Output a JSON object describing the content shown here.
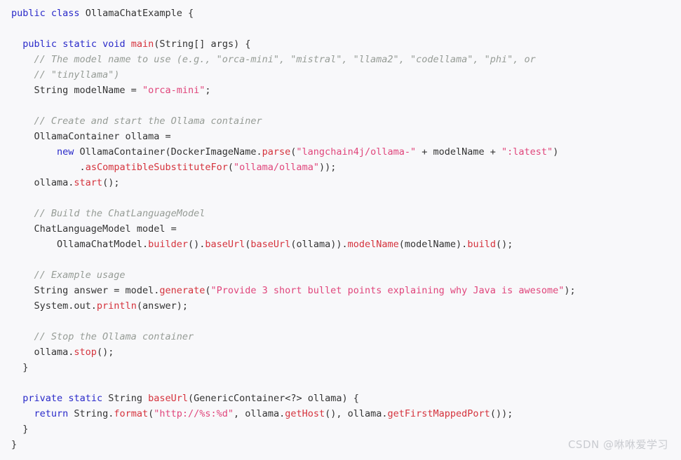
{
  "editor": {
    "language": "java",
    "background_color": "#f8f8fa",
    "default_text_color": "#333333",
    "keyword_color": "#2929c9",
    "comment_color": "#969c96",
    "string_color": "#e0457b",
    "method_color": "#d5323c",
    "class_name": "OllamaChatExample",
    "lines": [
      {
        "indent": 0,
        "tokens": [
          {
            "t": "public",
            "c": "kw"
          },
          {
            "t": " ",
            "c": "plain"
          },
          {
            "t": "class",
            "c": "kw"
          },
          {
            "t": " OllamaChatExample {",
            "c": "plain"
          }
        ]
      },
      {
        "indent": 0,
        "tokens": []
      },
      {
        "indent": 2,
        "tokens": [
          {
            "t": "public",
            "c": "kw"
          },
          {
            "t": " ",
            "c": "plain"
          },
          {
            "t": "static",
            "c": "kw"
          },
          {
            "t": " ",
            "c": "plain"
          },
          {
            "t": "void",
            "c": "kw"
          },
          {
            "t": " ",
            "c": "plain"
          },
          {
            "t": "main",
            "c": "fn"
          },
          {
            "t": "(String[] args) {",
            "c": "plain"
          }
        ]
      },
      {
        "indent": 4,
        "tokens": [
          {
            "t": "// The model name to use (e.g., \"orca-mini\", \"mistral\", \"llama2\", \"codellama\", \"phi\", or",
            "c": "com"
          }
        ]
      },
      {
        "indent": 4,
        "tokens": [
          {
            "t": "// \"tinyllama\")",
            "c": "com"
          }
        ]
      },
      {
        "indent": 4,
        "tokens": [
          {
            "t": "String modelName = ",
            "c": "plain"
          },
          {
            "t": "\"orca-mini\"",
            "c": "str"
          },
          {
            "t": ";",
            "c": "plain"
          }
        ]
      },
      {
        "indent": 0,
        "tokens": []
      },
      {
        "indent": 4,
        "tokens": [
          {
            "t": "// Create and start the Ollama container",
            "c": "com"
          }
        ]
      },
      {
        "indent": 4,
        "tokens": [
          {
            "t": "OllamaContainer ollama =",
            "c": "plain"
          }
        ]
      },
      {
        "indent": 8,
        "tokens": [
          {
            "t": "new",
            "c": "kw"
          },
          {
            "t": " OllamaContainer(DockerImageName.",
            "c": "plain"
          },
          {
            "t": "parse",
            "c": "fn"
          },
          {
            "t": "(",
            "c": "plain"
          },
          {
            "t": "\"langchain4j/ollama-\"",
            "c": "str"
          },
          {
            "t": " + modelName + ",
            "c": "plain"
          },
          {
            "t": "\":latest\"",
            "c": "str"
          },
          {
            "t": ")",
            "c": "plain"
          }
        ]
      },
      {
        "indent": 12,
        "tokens": [
          {
            "t": ".",
            "c": "plain"
          },
          {
            "t": "asCompatibleSubstituteFor",
            "c": "fn"
          },
          {
            "t": "(",
            "c": "plain"
          },
          {
            "t": "\"ollama/ollama\"",
            "c": "str"
          },
          {
            "t": "));",
            "c": "plain"
          }
        ]
      },
      {
        "indent": 4,
        "tokens": [
          {
            "t": "ollama.",
            "c": "plain"
          },
          {
            "t": "start",
            "c": "fn"
          },
          {
            "t": "();",
            "c": "plain"
          }
        ]
      },
      {
        "indent": 0,
        "tokens": []
      },
      {
        "indent": 4,
        "tokens": [
          {
            "t": "// Build the ChatLanguageModel",
            "c": "com"
          }
        ]
      },
      {
        "indent": 4,
        "tokens": [
          {
            "t": "ChatLanguageModel model =",
            "c": "plain"
          }
        ]
      },
      {
        "indent": 8,
        "tokens": [
          {
            "t": "OllamaChatModel.",
            "c": "plain"
          },
          {
            "t": "builder",
            "c": "fn"
          },
          {
            "t": "().",
            "c": "plain"
          },
          {
            "t": "baseUrl",
            "c": "fn"
          },
          {
            "t": "(",
            "c": "plain"
          },
          {
            "t": "baseUrl",
            "c": "fn"
          },
          {
            "t": "(ollama)).",
            "c": "plain"
          },
          {
            "t": "modelName",
            "c": "fn"
          },
          {
            "t": "(modelName).",
            "c": "plain"
          },
          {
            "t": "build",
            "c": "fn"
          },
          {
            "t": "();",
            "c": "plain"
          }
        ]
      },
      {
        "indent": 0,
        "tokens": []
      },
      {
        "indent": 4,
        "tokens": [
          {
            "t": "// Example usage",
            "c": "com"
          }
        ]
      },
      {
        "indent": 4,
        "tokens": [
          {
            "t": "String answer = model.",
            "c": "plain"
          },
          {
            "t": "generate",
            "c": "fn"
          },
          {
            "t": "(",
            "c": "plain"
          },
          {
            "t": "\"Provide 3 short bullet points explaining why Java is awesome\"",
            "c": "str"
          },
          {
            "t": ");",
            "c": "plain"
          }
        ]
      },
      {
        "indent": 4,
        "tokens": [
          {
            "t": "System.out.",
            "c": "plain"
          },
          {
            "t": "println",
            "c": "fn"
          },
          {
            "t": "(answer);",
            "c": "plain"
          }
        ]
      },
      {
        "indent": 0,
        "tokens": []
      },
      {
        "indent": 4,
        "tokens": [
          {
            "t": "// Stop the Ollama container",
            "c": "com"
          }
        ]
      },
      {
        "indent": 4,
        "tokens": [
          {
            "t": "ollama.",
            "c": "plain"
          },
          {
            "t": "stop",
            "c": "fn"
          },
          {
            "t": "();",
            "c": "plain"
          }
        ]
      },
      {
        "indent": 2,
        "tokens": [
          {
            "t": "}",
            "c": "plain"
          }
        ]
      },
      {
        "indent": 0,
        "tokens": []
      },
      {
        "indent": 2,
        "tokens": [
          {
            "t": "private",
            "c": "kw"
          },
          {
            "t": " ",
            "c": "plain"
          },
          {
            "t": "static",
            "c": "kw"
          },
          {
            "t": " String ",
            "c": "plain"
          },
          {
            "t": "baseUrl",
            "c": "fn"
          },
          {
            "t": "(GenericContainer<?> ollama) {",
            "c": "plain"
          }
        ]
      },
      {
        "indent": 4,
        "tokens": [
          {
            "t": "return",
            "c": "kw"
          },
          {
            "t": " String.",
            "c": "plain"
          },
          {
            "t": "format",
            "c": "fn"
          },
          {
            "t": "(",
            "c": "plain"
          },
          {
            "t": "\"http://%s:%d\"",
            "c": "str"
          },
          {
            "t": ", ollama.",
            "c": "plain"
          },
          {
            "t": "getHost",
            "c": "fn"
          },
          {
            "t": "(), ollama.",
            "c": "plain"
          },
          {
            "t": "getFirstMappedPort",
            "c": "fn"
          },
          {
            "t": "());",
            "c": "plain"
          }
        ]
      },
      {
        "indent": 2,
        "tokens": [
          {
            "t": "}",
            "c": "plain"
          }
        ]
      },
      {
        "indent": 0,
        "tokens": [
          {
            "t": "}",
            "c": "plain"
          }
        ]
      }
    ]
  },
  "watermark": {
    "text": "CSDN @咻咻爱学习"
  }
}
